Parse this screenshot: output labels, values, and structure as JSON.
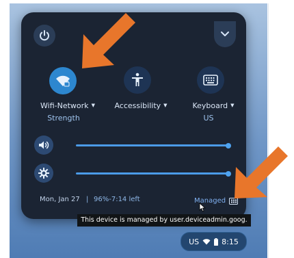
{
  "quick_settings": {
    "tiles": [
      {
        "label": "Wifi-Network",
        "sublabel": "Strength",
        "icon": "wifi-lock-icon"
      },
      {
        "label": "Accessibility",
        "sublabel": "",
        "icon": "accessibility-icon"
      },
      {
        "label": "Keyboard",
        "sublabel": "US",
        "icon": "keyboard-icon"
      }
    ],
    "sliders": {
      "volume": {
        "icon": "volume-icon",
        "level": 1.0
      },
      "brightness": {
        "icon": "brightness-icon",
        "level": 1.0
      }
    },
    "footer": {
      "date": "Mon, Jan 27",
      "separator": "|",
      "battery": "96%-7:14 left",
      "managed_label": "Managed"
    },
    "tooltip": "This device is managed by user.deviceadmin.goog.",
    "status": {
      "locale": "US",
      "time": "8:15"
    }
  },
  "colors": {
    "panel": "#1b2433",
    "accent": "#2d87cf",
    "annotation_arrow": "#e8762b"
  }
}
